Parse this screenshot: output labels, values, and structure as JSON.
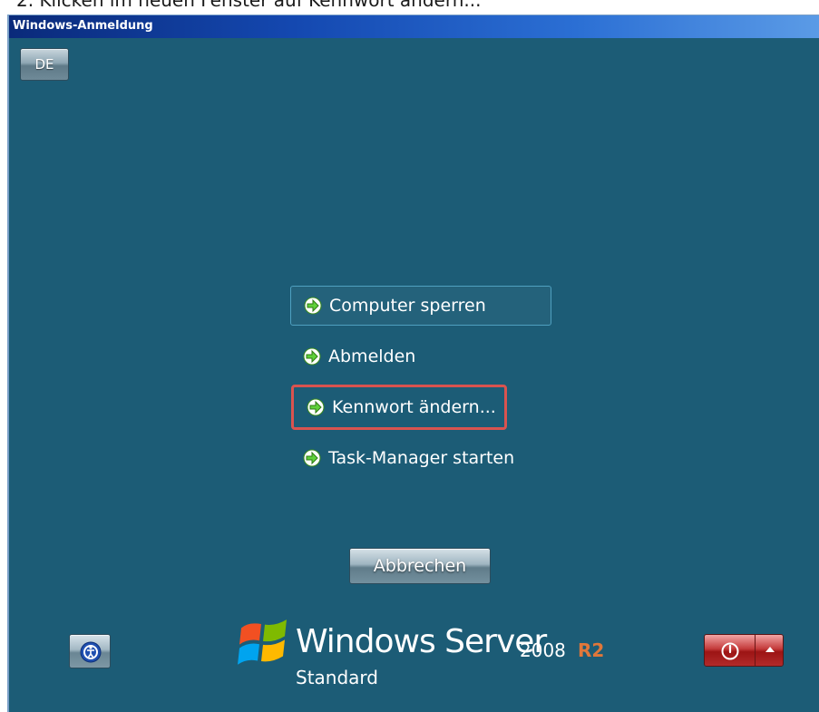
{
  "caption": "2. Klicken im neuen Fenster auf Kennwort ändern...",
  "window": {
    "title": "Windows-Anmeldung"
  },
  "language_button": {
    "label": "DE"
  },
  "options": [
    {
      "label": "Computer sperren",
      "icon": "green-arrow-icon"
    },
    {
      "label": "Abmelden",
      "icon": "green-arrow-icon"
    },
    {
      "label": "Kennwort ändern...",
      "icon": "green-arrow-icon"
    },
    {
      "label": "Task-Manager starten",
      "icon": "green-arrow-icon"
    }
  ],
  "cancel_button": {
    "label": "Abbrechen"
  },
  "brand": {
    "product": "Windows Server",
    "year": "2008",
    "release": "R2",
    "edition": "Standard"
  },
  "icons": {
    "access": "ease-of-access-icon",
    "power": "power-icon",
    "power_menu": "arrow-up-icon",
    "logo": "windows-flag-logo"
  },
  "colors": {
    "background": "#1c5c76",
    "titlebar": "#1448b0",
    "highlight_outline": "#d9534f",
    "r2_accent": "#e0773a",
    "arrow_green": "#5fd03a"
  }
}
